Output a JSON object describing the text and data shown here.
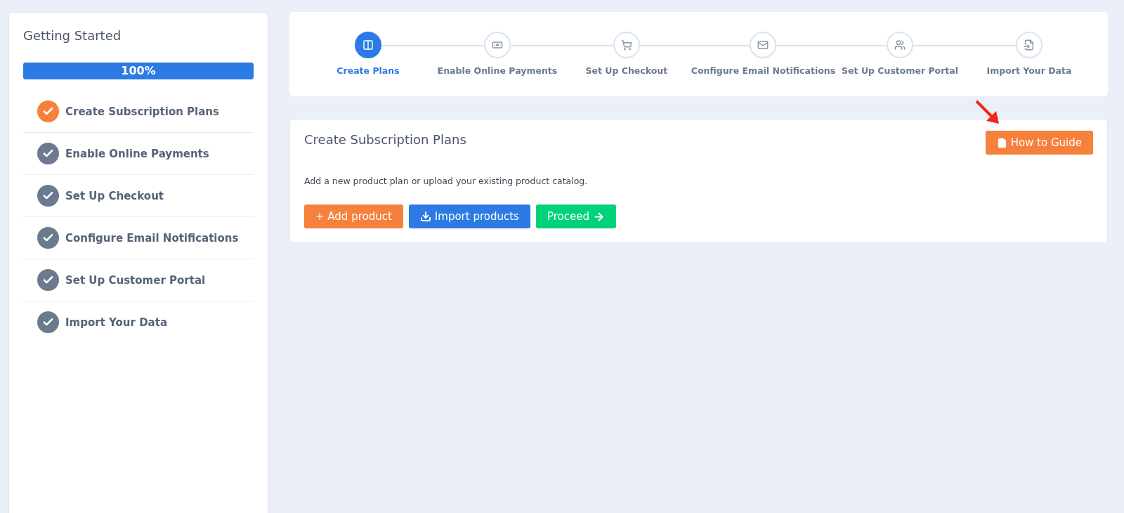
{
  "sidebar": {
    "title": "Getting Started",
    "progress": {
      "level": 1,
      "reading": "100%"
    },
    "items": [
      {
        "label": "Create Subscription Plans",
        "checked": true,
        "selected": true
      },
      {
        "label": "Enable Online Payments",
        "checked": true,
        "selected": false
      },
      {
        "label": "Set Up Checkout",
        "checked": true,
        "selected": false
      },
      {
        "label": "Configure Email Notifications",
        "checked": true,
        "selected": false
      },
      {
        "label": "Set Up Customer Portal",
        "checked": true,
        "selected": false
      },
      {
        "label": "Import Your Data",
        "checked": true,
        "selected": false
      }
    ]
  },
  "stepper": {
    "steps": [
      {
        "label": "Create Plans",
        "selected": true
      },
      {
        "label": "Enable Online Payments",
        "selected": false
      },
      {
        "label": "Set Up Checkout",
        "selected": false
      },
      {
        "label": "Configure Email Notifications",
        "selected": false
      },
      {
        "label": "Set Up Customer Portal",
        "selected": false
      },
      {
        "label": "Import Your Data",
        "selected": false
      }
    ]
  },
  "card": {
    "title": "Create Subscription Plans",
    "guide_button": "How to Guide",
    "description": "Add a new product plan or upload your existing product catalog.",
    "buttons": [
      {
        "kind": "add",
        "label": "+ Add product"
      },
      {
        "kind": "import",
        "label": "Import products"
      },
      {
        "kind": "proceed",
        "label": "Proceed"
      }
    ]
  }
}
